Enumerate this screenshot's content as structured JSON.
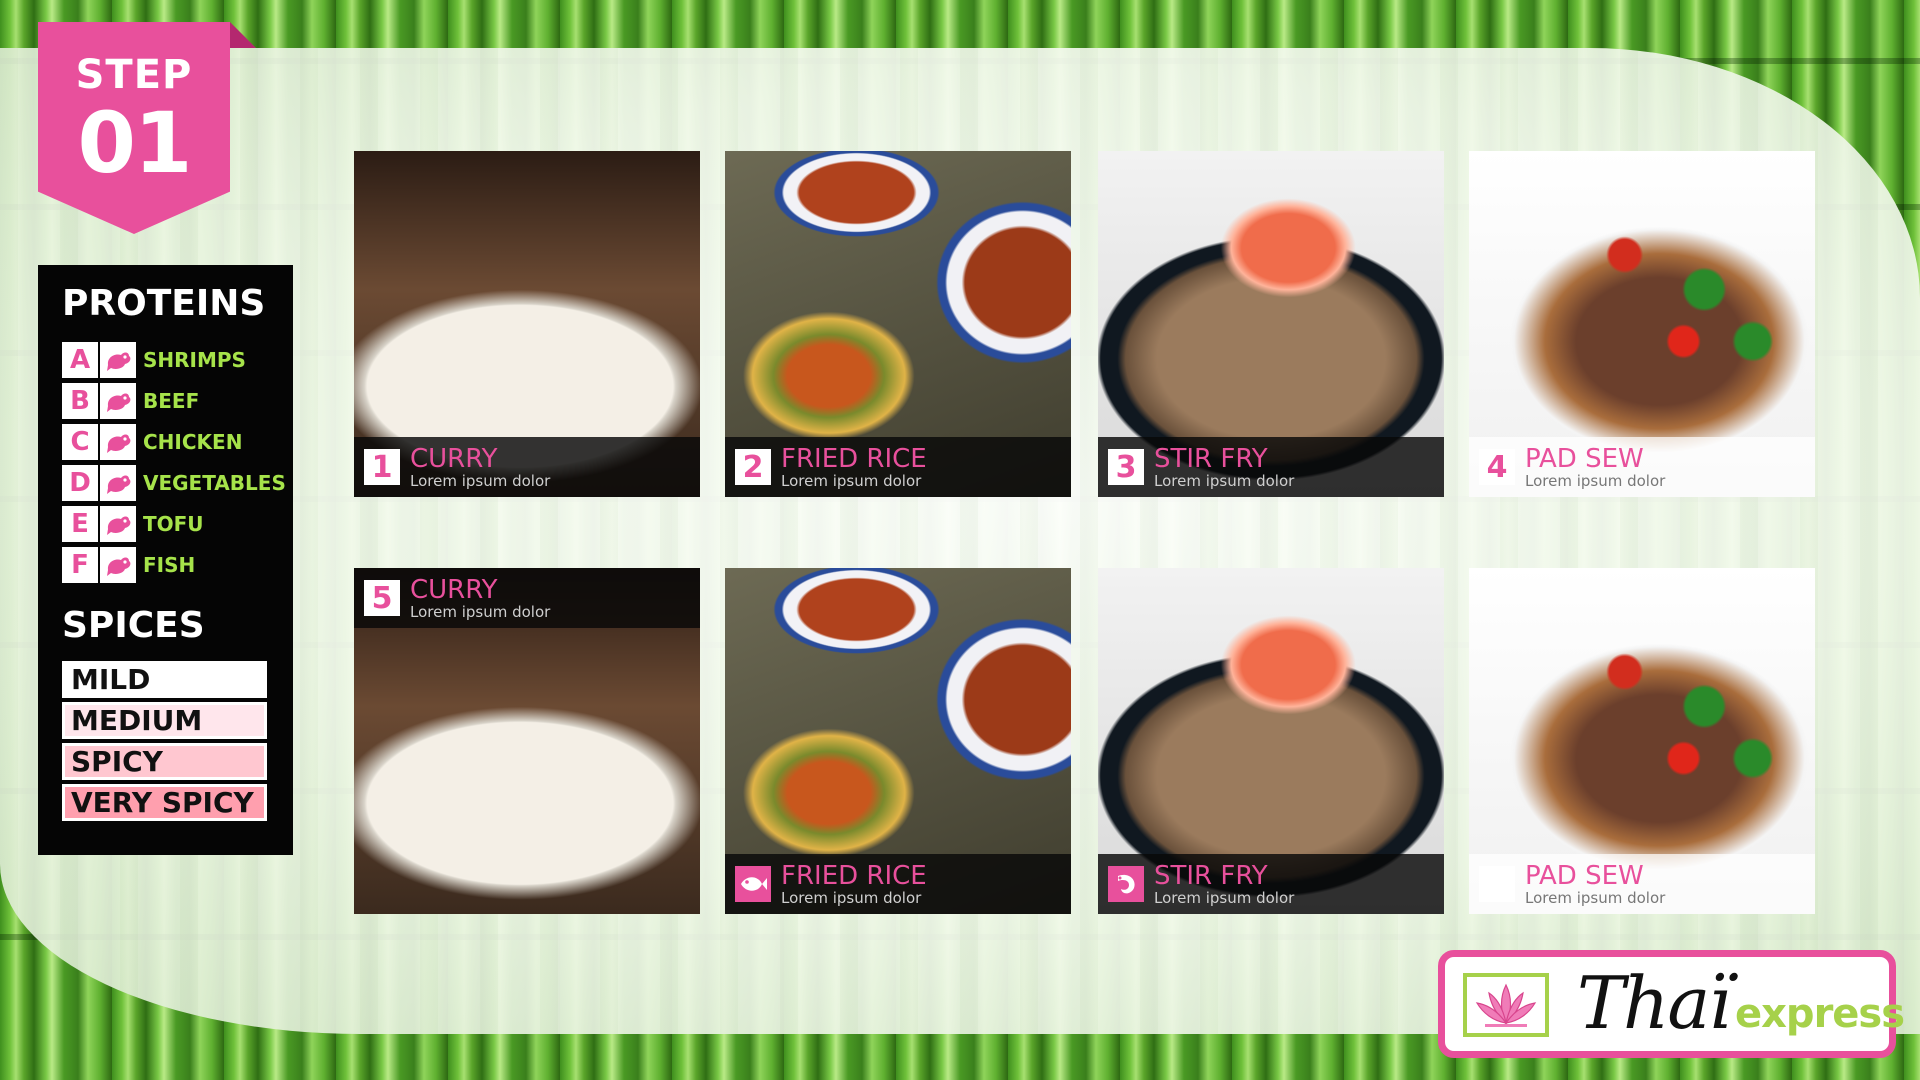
{
  "step": {
    "label": "STEP",
    "number": "01"
  },
  "proteins": {
    "title": "PROTEINS",
    "items": [
      {
        "letter": "A",
        "name": "SHRIMPS"
      },
      {
        "letter": "B",
        "name": "BEEF"
      },
      {
        "letter": "C",
        "name": "CHICKEN"
      },
      {
        "letter": "D",
        "name": "VEGETABLES"
      },
      {
        "letter": "E",
        "name": "TOFU"
      },
      {
        "letter": "F",
        "name": "FISH"
      }
    ]
  },
  "spices": {
    "title": "SPICES",
    "items": [
      {
        "name": "MILD",
        "color": "#ffffff"
      },
      {
        "name": "MEDIUM",
        "color": "#ffe6ec"
      },
      {
        "name": "SPICY",
        "color": "#ffc7d0"
      },
      {
        "name": "VERY SPICY",
        "color": "#ff9fae"
      }
    ]
  },
  "menu": [
    {
      "num": "1",
      "name": "CURRY",
      "sub": "Lorem ipsum dolor"
    },
    {
      "num": "2",
      "name": "FRIED RICE",
      "sub": "Lorem ipsum dolor"
    },
    {
      "num": "3",
      "name": "STIR FRY",
      "sub": "Lorem ipsum dolor"
    },
    {
      "num": "4",
      "name": "PAD SEW",
      "sub": "Lorem ipsum dolor"
    },
    {
      "num": "5",
      "name": "CURRY",
      "sub": "Lorem ipsum dolor"
    },
    {
      "num": "",
      "name": "FRIED RICE",
      "sub": "Lorem ipsum dolor",
      "icon": "fish-icon"
    },
    {
      "num": "",
      "name": "STIR FRY",
      "sub": "Lorem ipsum dolor",
      "icon": "shrimp-icon"
    },
    {
      "num": "",
      "name": "PAD SEW",
      "sub": "Lorem ipsum dolor"
    }
  ],
  "logo": {
    "brand": "Thaï",
    "suffix": "express",
    "icon": "lotus-icon"
  },
  "colors": {
    "accent": "#e8509c",
    "green": "#a6e34a",
    "sidebar": "#050505"
  }
}
